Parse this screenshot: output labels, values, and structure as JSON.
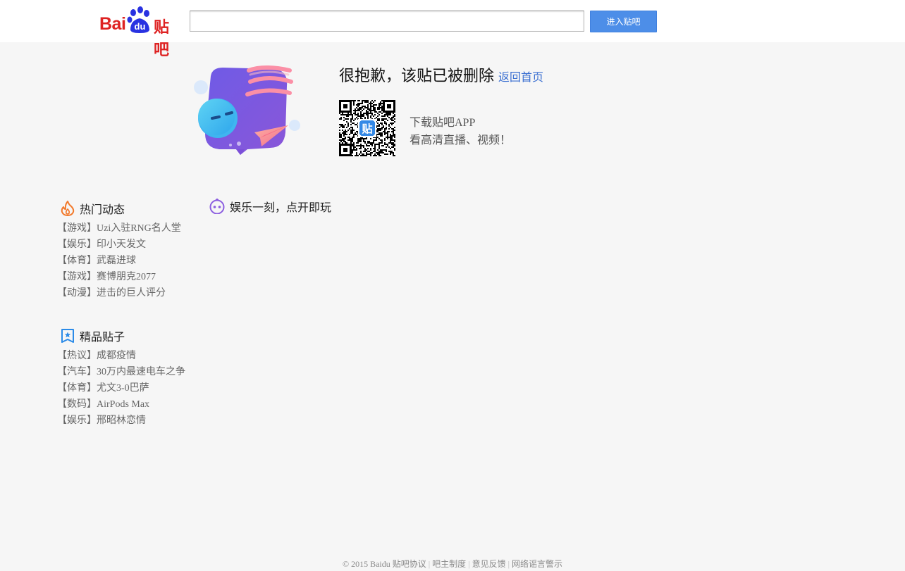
{
  "header": {
    "logo_text": "Bai",
    "logo_paw_text": "du",
    "logo_suffix": "贴吧",
    "search_value": "",
    "enter_button_label": "进入贴吧",
    "brand_color": "#de2222",
    "button_color": "#4d8ee8"
  },
  "notice": {
    "title": "很抱歉，该贴已被删除",
    "home_link": "返回首页",
    "qr_icon_text": "贴",
    "app_line1": "下载贴吧APP",
    "app_line2": "看高清直播、视频！"
  },
  "hot": {
    "title": "热门动态",
    "icon": "flame-icon",
    "items": [
      "【游戏】Uzi入驻RNG名人堂",
      "【娱乐】印小天发文",
      "【体育】武磊进球",
      "【游戏】赛博朋克2077",
      "【动漫】进击的巨人评分"
    ]
  },
  "fine": {
    "title": "精品贴子",
    "icon": "bookmark-star-icon",
    "items": [
      "【热议】成都疫情",
      "【汽车】30万内最速电车之争",
      "【体育】尤文3-0巴萨",
      "【数码】AirPods Max",
      "【娱乐】邢昭林恋情"
    ]
  },
  "entertainment": {
    "title": "娱乐一刻，点开即玩",
    "icon": "game-face-icon"
  },
  "footer": {
    "copyright": "© 2015 Baidu",
    "links": [
      "贴吧协议",
      "吧主制度",
      "意见反馈",
      "网络谣言警示"
    ]
  }
}
